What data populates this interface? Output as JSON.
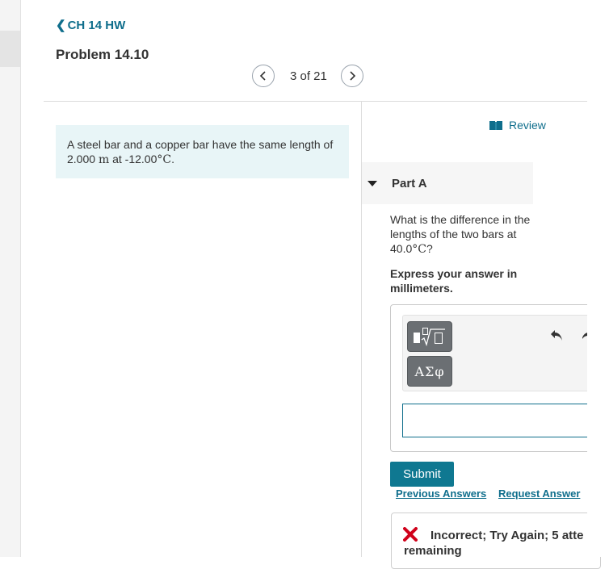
{
  "nav": {
    "back_label": "CH 14 HW",
    "problem_title": "Problem 14.10",
    "pager_text": "3 of 21"
  },
  "intro": {
    "text_before": "A steel bar and a copper bar have the same length of 2.000",
    "unit_m": "m",
    "text_mid": " at -12.00",
    "unit_c": "°C",
    "text_end": "."
  },
  "review": {
    "label": "Review"
  },
  "part": {
    "label": "Part A",
    "question_before": "What is the difference in the lengths of the two bars at 40.0",
    "question_unit": "°C",
    "question_end": "?",
    "instruction": "Express your answer in millimeters."
  },
  "toolbar": {
    "templates_icon": "square-root-template-icon",
    "symbols_label": "ΑΣφ",
    "undo_icon": "undo-icon",
    "redo_icon": "redo-icon"
  },
  "answer": {
    "value": ""
  },
  "actions": {
    "submit_label": "Submit",
    "previous_answers_label": "Previous Answers",
    "request_answer_label": "Request Answer"
  },
  "feedback": {
    "icon": "red-x-icon",
    "message": "Incorrect; Try Again; 5 atte remaining"
  },
  "colors": {
    "accent": "#0f6e8c",
    "submit_bg": "#0f7891",
    "intro_bg": "#e8f5f7",
    "error_red": "#d0021b"
  }
}
